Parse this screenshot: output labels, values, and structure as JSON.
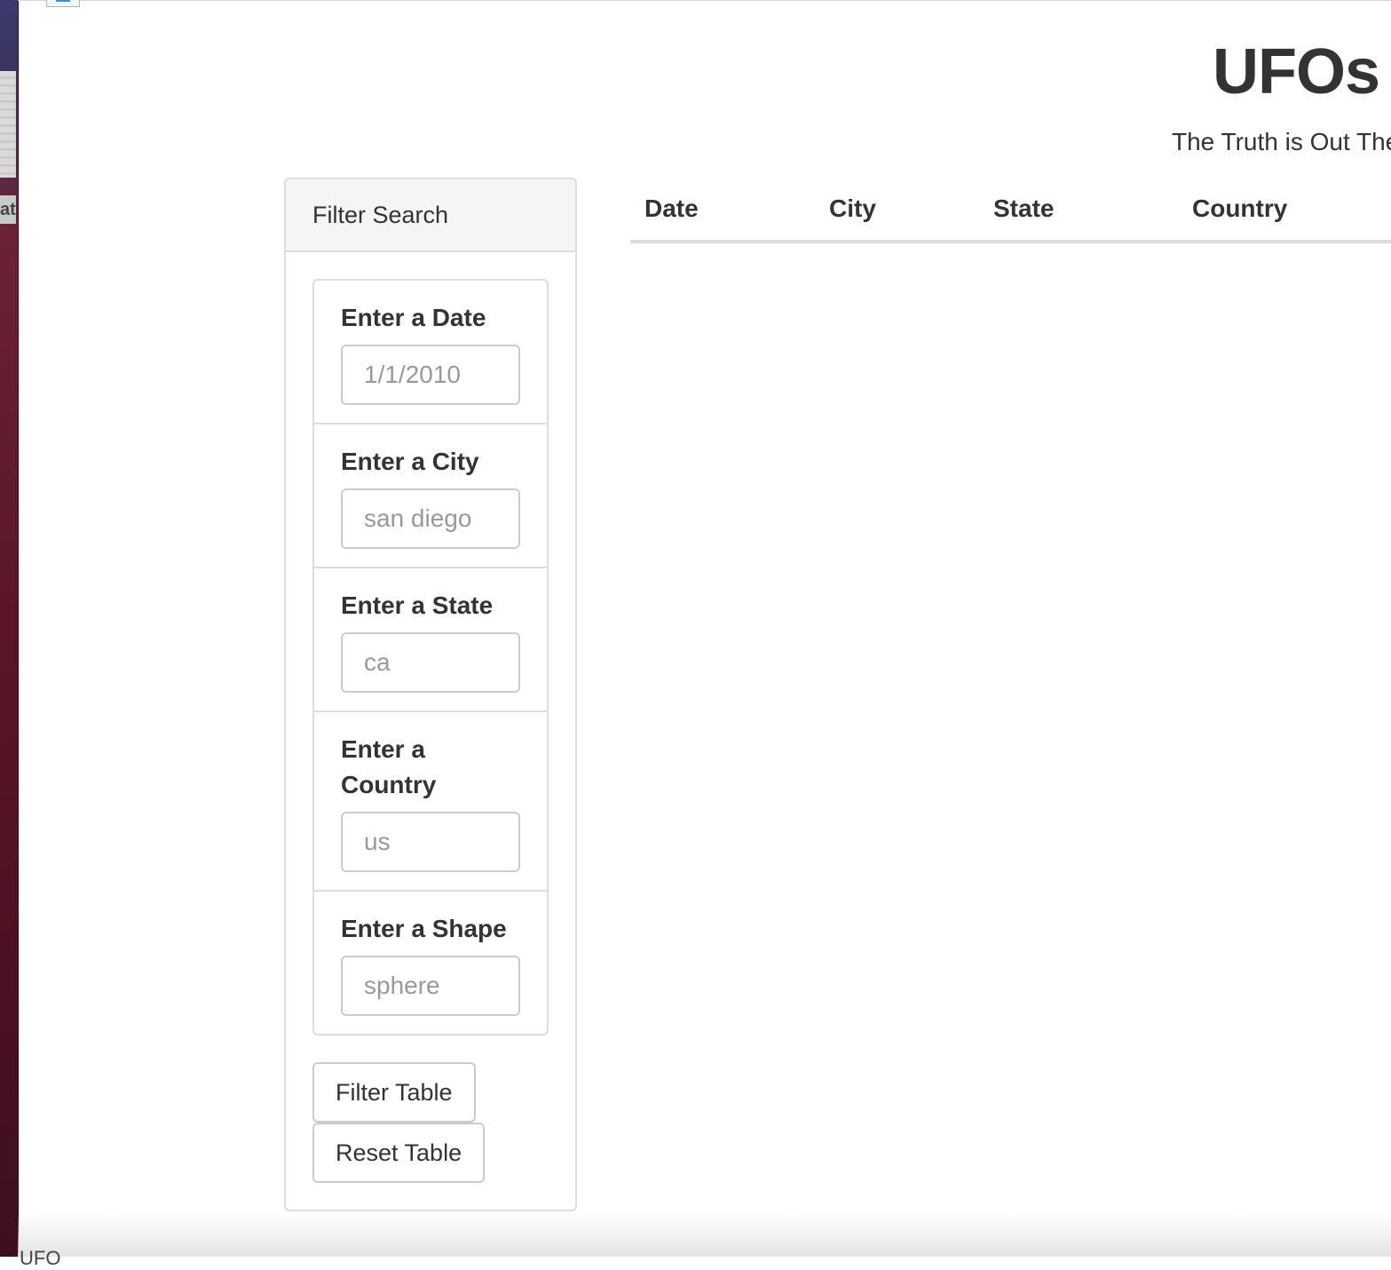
{
  "desktop": {
    "left_edge_text": "at"
  },
  "header": {
    "title": "UFOs",
    "subtitle": "The Truth is Out There"
  },
  "filter_panel": {
    "heading": "Filter Search",
    "filters": [
      {
        "label": "Enter a Date",
        "placeholder": "1/1/2010"
      },
      {
        "label": "Enter a City",
        "placeholder": "san diego"
      },
      {
        "label": "Enter a State",
        "placeholder": "ca"
      },
      {
        "label": "Enter a Country",
        "placeholder": "us"
      },
      {
        "label": "Enter a Shape",
        "placeholder": "sphere"
      }
    ],
    "filter_button": "Filter Table",
    "reset_button": "Reset Table"
  },
  "table": {
    "columns": [
      "Date",
      "City",
      "State",
      "Country"
    ],
    "rows": []
  },
  "footer": {
    "partial_text": "UFO"
  }
}
